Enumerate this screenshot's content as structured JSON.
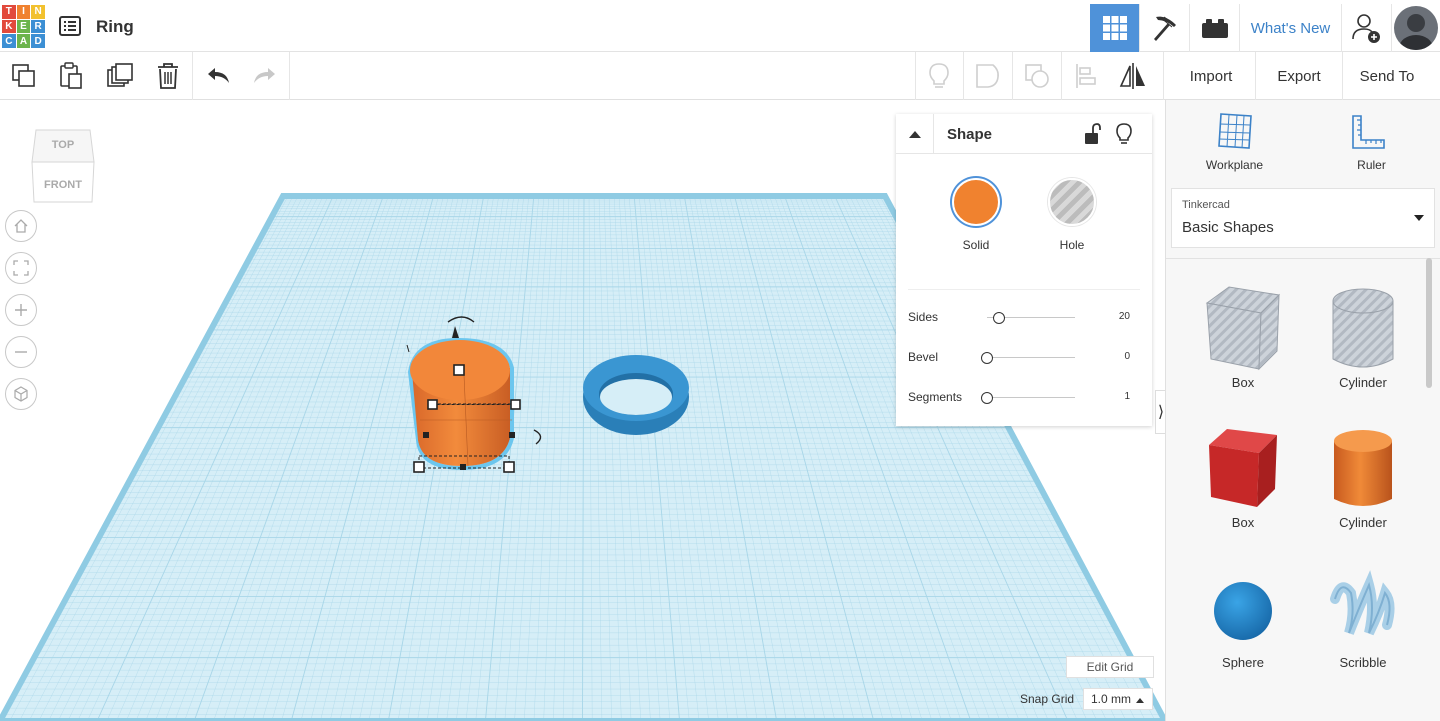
{
  "header": {
    "logo_letters": [
      "T",
      "I",
      "N",
      "K",
      "E",
      "R",
      "C",
      "A",
      "D"
    ],
    "logo_colors": [
      "#e24a3c",
      "#f0812f",
      "#f2c12e",
      "#e24a3c",
      "#6cb44c",
      "#3c8fd4",
      "#3c8fd4",
      "#6cb44c",
      "#3c8fd4"
    ],
    "design_title": "Ring",
    "whats_new": "What's New"
  },
  "toolbar": {
    "import": "Import",
    "export": "Export",
    "send_to": "Send To"
  },
  "viewcube": {
    "top": "TOP",
    "front": "FRONT"
  },
  "shape_panel": {
    "title": "Shape",
    "materials": [
      {
        "label": "Solid",
        "color": "#f0822f",
        "selected": true
      },
      {
        "label": "Hole",
        "selected": false
      }
    ],
    "properties": [
      {
        "label": "Sides",
        "value": "20",
        "level": 0.14
      },
      {
        "label": "Bevel",
        "value": "0",
        "level": 0
      },
      {
        "label": "Segments",
        "value": "1",
        "level": 0
      }
    ]
  },
  "grid_controls": {
    "edit_grid": "Edit Grid",
    "snap_grid_label": "Snap Grid",
    "snap_grid_value": "1.0 mm"
  },
  "sidebar": {
    "workplane": "Workplane",
    "ruler": "Ruler",
    "library_group": "Tinkercad",
    "library_name": "Basic Shapes",
    "shapes": [
      {
        "label": "Box"
      },
      {
        "label": "Cylinder"
      },
      {
        "label": "Box"
      },
      {
        "label": "Cylinder"
      },
      {
        "label": "Sphere"
      },
      {
        "label": "Scribble"
      }
    ]
  },
  "colors": {
    "accent": "#4f92d9",
    "grid_fill": "#d6eef7",
    "grid_line": "#a8d6e8",
    "solid_orange": "#f0822f",
    "ring_blue": "#2f8cc8"
  }
}
